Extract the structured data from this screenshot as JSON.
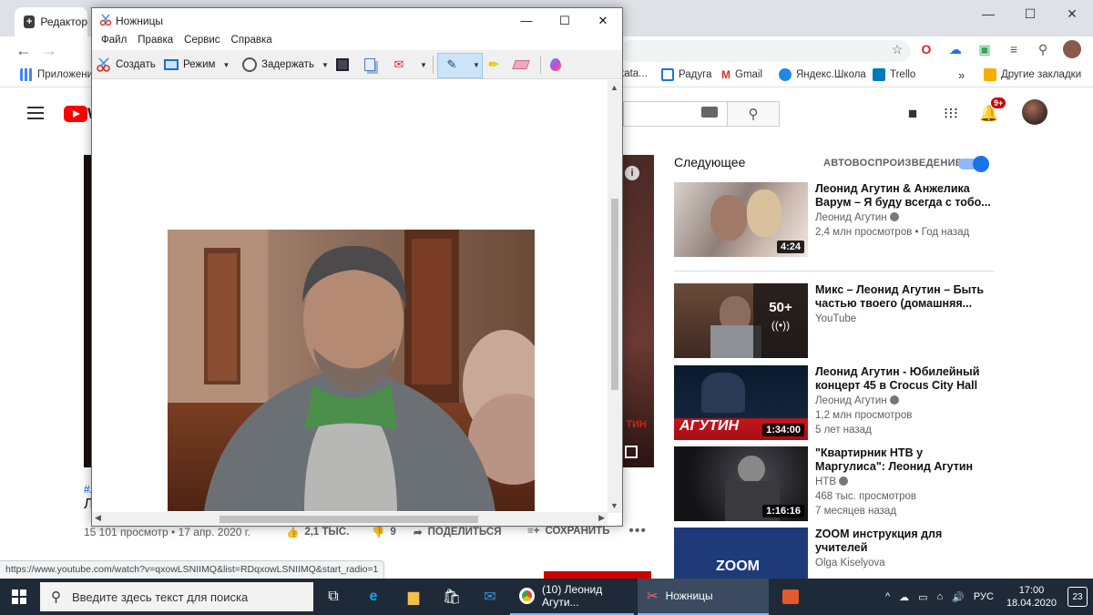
{
  "browser": {
    "tab_title": "Редактор",
    "window_controls": [
      "—",
      "☐",
      "✕"
    ],
    "bookmarks": [
      {
        "label": "Приложения",
        "color": "#4285f4"
      },
      {
        "label": "tata...",
        "color": "#777777"
      },
      {
        "label": "Радуга",
        "color": "#1a73e8"
      },
      {
        "label": "Gmail",
        "color": "#d93025"
      },
      {
        "label": "Яндекс.Школа",
        "color": "#1e88e5"
      },
      {
        "label": "Trello",
        "color": "#0079bf"
      },
      {
        "label": "»",
        "color": ""
      },
      {
        "label": "Другие закладки",
        "color": "#f9ab00"
      }
    ],
    "status_url": "https://www.youtube.com/watch?v=qxowLSNIIMQ&list=RDqxowLSNIIMQ&start_radio=1"
  },
  "youtube": {
    "logo_letter": "W",
    "notification_count": "9+",
    "up_next_label": "Следующее",
    "autoplay_label": "АВТОВОСПРОИЗВЕДЕНИЕ",
    "player_overlay_text": "ТИН",
    "video_hashtag": "#Л",
    "video_title_fragment": "Л",
    "views_date": "15 101 просмотр • 17 апр. 2020 г.",
    "likes": "2,1 ТЫС.",
    "dislikes": "9",
    "share_label": "ПОДЕЛИТЬСЯ",
    "save_label": "СОХРАНИТЬ",
    "recommendations": [
      {
        "title": "Леонид Агутин & Анжелика Варум – Я буду всегда с тобо...",
        "channel": "Леонид Агутин",
        "verified": true,
        "stat": "2,4 млн просмотров • Год назад",
        "stat2": "",
        "duration": "4:24"
      },
      {
        "title": "Микс – Леонид Агутин – Быть частью твоего (домашняя...",
        "channel": "YouTube",
        "verified": false,
        "stat": "",
        "stat2": "",
        "mix_count": "50+",
        "mix_icon": "((•))"
      },
      {
        "title": "Леонид Агутин - Юбилейный концерт 45 в Crocus City Hall",
        "channel": "Леонид Агутин",
        "verified": true,
        "stat": "1,2 млн просмотров",
        "stat2": "5 лет назад",
        "duration": "1:34:00",
        "thumb_text": "АГУТИН"
      },
      {
        "title": "\"Квартирник НТВ у Маргулиса\": Леонид Агутин",
        "channel": "НТВ",
        "verified": true,
        "stat": "468 тыс. просмотров",
        "stat2": "7 месяцев назад",
        "duration": "1:16:16"
      },
      {
        "title": "ZOOM инструкция для учителей",
        "channel": "Olga Kiselyova",
        "verified": false,
        "stat": "",
        "stat2": "",
        "thumb_text": "ZOOM"
      }
    ]
  },
  "snipping_tool": {
    "title": "Ножницы",
    "menu": [
      "Файл",
      "Правка",
      "Сервис",
      "Справка"
    ],
    "toolbar": {
      "create_label": "Создать",
      "mode_label": "Режим",
      "delay_label": "Задержать"
    }
  },
  "taskbar": {
    "search_placeholder": "Введите здесь текст для поиска",
    "apps": [
      {
        "label": "(10) Леонид Агути...",
        "icon": "chrome-icon"
      },
      {
        "label": "Ножницы",
        "icon": "snipping-tool-icon"
      }
    ],
    "language": "РУС",
    "time": "17:00",
    "date": "18.04.2020",
    "notifications": "23"
  }
}
